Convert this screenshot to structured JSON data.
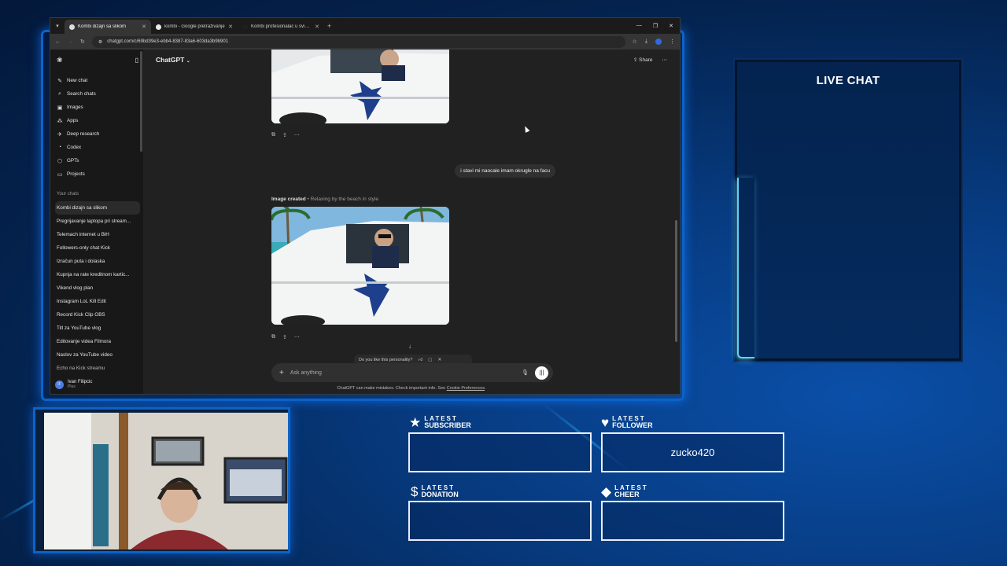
{
  "browser": {
    "tabs": [
      {
        "title": "Kombi dizajn sa slikom",
        "active": true
      },
      {
        "title": "kombi - Google pretraživanje",
        "active": false
      },
      {
        "title": "Kombi profesionalac u svim b...",
        "active": false
      }
    ],
    "url": "chatgpt.com/c/69bd39e3-ebb4-8387-83a6-603da3b9b901"
  },
  "sidebar": {
    "nav": [
      {
        "label": "New chat",
        "icon": "edit-icon"
      },
      {
        "label": "Search chats",
        "icon": "search-icon"
      },
      {
        "label": "Images",
        "icon": "image-icon"
      },
      {
        "label": "Apps",
        "icon": "apps-icon"
      },
      {
        "label": "Deep research",
        "icon": "research-icon"
      },
      {
        "label": "Codex",
        "icon": "codex-icon"
      },
      {
        "label": "GPTs",
        "icon": "gpts-icon"
      },
      {
        "label": "Projects",
        "icon": "folder-icon"
      }
    ],
    "section_label": "Your chats",
    "chats": [
      "Kombi dizajn sa slikom",
      "Pregrijavanje laptopa pri stream...",
      "Telemach internet u BiH",
      "Followers-only chat Kick",
      "Izračun puta i dolaska",
      "Kupnja na rate kreditnom kartic...",
      "Vikend vlog plan",
      "Instagram LoL Kill Edit",
      "Record Kick Clip OBS",
      "Titl za YouTube vlog",
      "Editovanje videa Filmora",
      "Naslov za YouTube video",
      "Echo na Kick streamu"
    ],
    "user": {
      "name": "Ivan Filipcic",
      "plan": "Plus",
      "initials": "IF"
    }
  },
  "main": {
    "model": "ChatGPT",
    "share_label": "Share",
    "user_message": "i stavi mi naocale imam okrugle na facu",
    "image_caption": "Image created",
    "image_subtitle": " • Relaxing by the beach in style",
    "feedback_question": "Do you like this personality?",
    "composer_placeholder": "Ask anything",
    "disclaimer": "ChatGPT can make mistakes. Check important info. See ",
    "disclaimer_link": "Cookie Preferences",
    "disclaimer_end": "."
  },
  "livechat": {
    "title": "LIVE CHAT"
  },
  "alerts": {
    "subscriber": {
      "top": "LATEST",
      "bottom": "SUBSCRIBER",
      "value": ""
    },
    "follower": {
      "top": "LATEST",
      "bottom": "FOLLOWER",
      "value": "zucko420"
    },
    "donation": {
      "top": "LATEST",
      "bottom": "DONATION",
      "value": ""
    },
    "cheer": {
      "top": "LATEST",
      "bottom": "CHEER",
      "value": ""
    }
  }
}
